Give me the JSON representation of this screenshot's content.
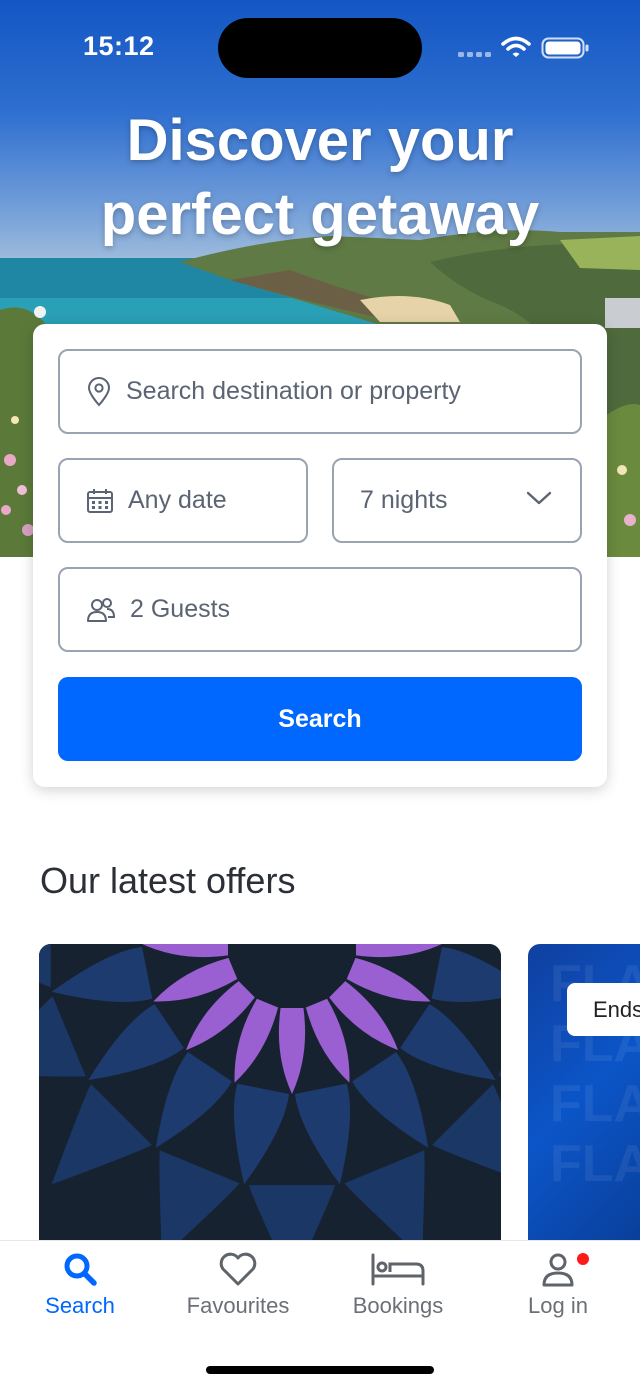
{
  "status_bar": {
    "time": "15:12"
  },
  "hero": {
    "title_line1": "Discover your",
    "title_line2": "perfect getaway"
  },
  "search_form": {
    "destination_placeholder": "Search destination or property",
    "date_value": "Any date",
    "nights_value": "7 nights",
    "guests_value": "2 Guests",
    "search_label": "Search"
  },
  "offers": {
    "title": "Our latest offers",
    "second_card_badge": "Ends",
    "second_card_watermark": "FLA"
  },
  "tabbar": {
    "items": [
      {
        "label": "Search",
        "icon": "search-icon",
        "active": true
      },
      {
        "label": "Favourites",
        "icon": "heart-icon",
        "active": false
      },
      {
        "label": "Bookings",
        "icon": "bed-icon",
        "active": false
      },
      {
        "label": "Log in",
        "icon": "user-icon",
        "active": false,
        "notification": true
      }
    ]
  },
  "colors": {
    "primary": "#0067ff",
    "notification": "#ff1a1a",
    "offer_purple": "#9a5fd0",
    "offer_navy": "#172230"
  }
}
